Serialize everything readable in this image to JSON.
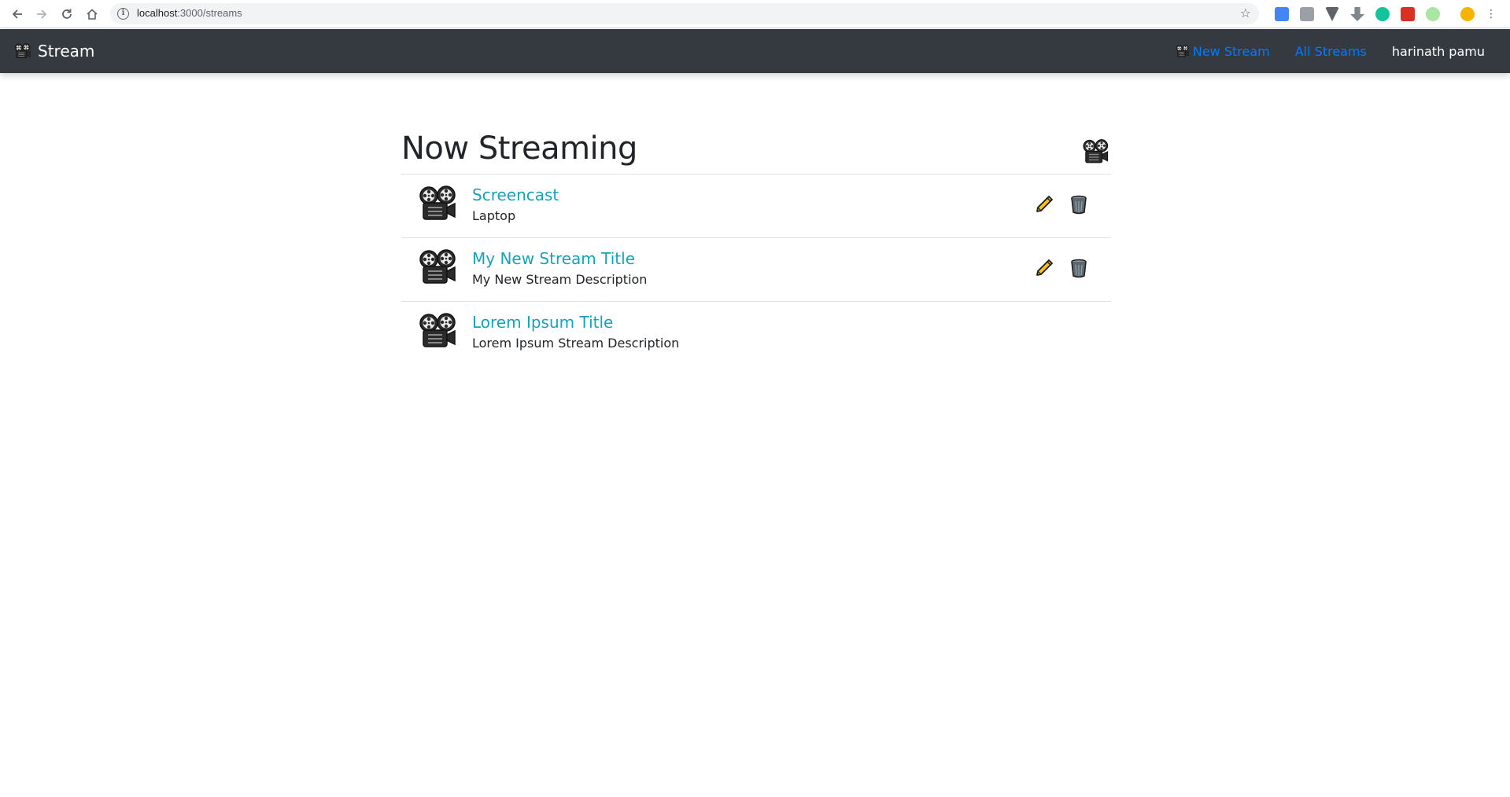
{
  "browser": {
    "url_host": "localhost",
    "url_path": ":3000/streams",
    "icons": [
      "back-icon",
      "forward-icon",
      "reload-icon",
      "home-icon",
      "info-icon",
      "bookmark-star-icon"
    ]
  },
  "navbar": {
    "brand": "Stream",
    "new_stream": "New Stream",
    "all_streams": "All Streams",
    "user": "harinath pamu",
    "colors": {
      "background": "#343a40",
      "link": "#007bff",
      "text": "#ffffff"
    }
  },
  "main": {
    "title": "Now Streaming",
    "streams": [
      {
        "title": "Screencast",
        "description": "Laptop",
        "can_edit": true
      },
      {
        "title": "My New Stream Title",
        "description": "My New Stream Description",
        "can_edit": true
      },
      {
        "title": "Lorem Ipsum Title",
        "description": "Lorem Ipsum Stream Description",
        "can_edit": false
      }
    ],
    "colors": {
      "stream_title": "#17a2b8",
      "divider": "#dee2e6"
    }
  }
}
